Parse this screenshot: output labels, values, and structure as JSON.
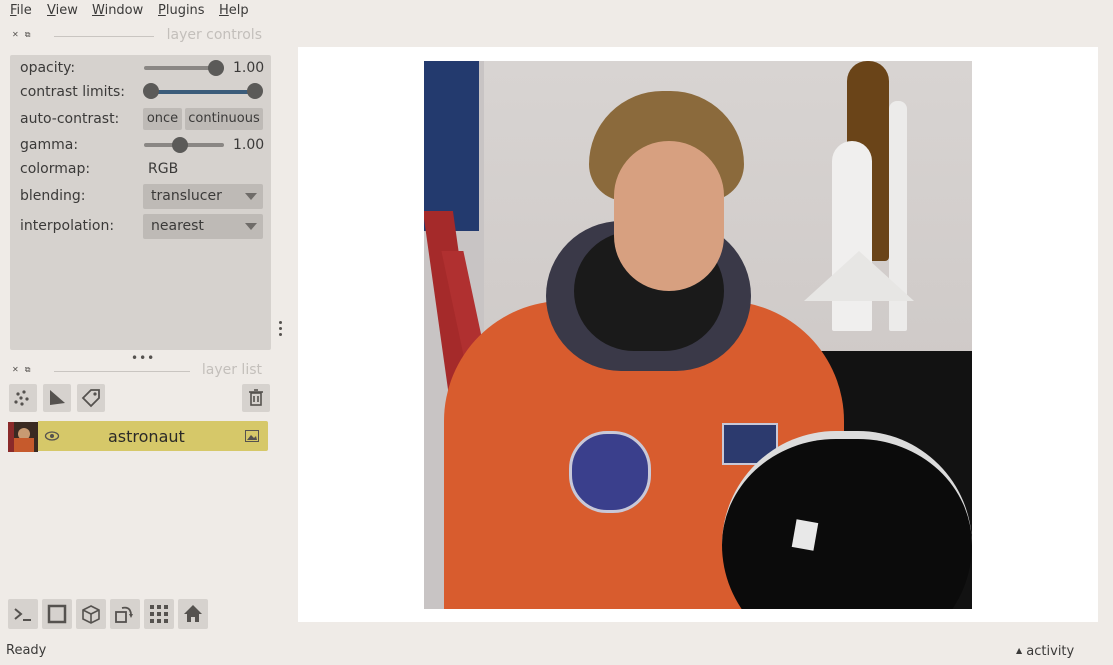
{
  "menu": [
    {
      "label": "File",
      "u": "F",
      "rest": "ile"
    },
    {
      "label": "View",
      "u": "V",
      "rest": "iew"
    },
    {
      "label": "Window",
      "u": "W",
      "rest": "indow"
    },
    {
      "label": "Plugins",
      "u": "P",
      "rest": "lugins"
    },
    {
      "label": "Help",
      "u": "H",
      "rest": "elp"
    }
  ],
  "layer_controls": {
    "title": "layer controls",
    "opacity_label": "opacity:",
    "opacity_value": "1.00",
    "opacity_level": 1.0,
    "contrast_label": "contrast limits:",
    "contrast_range": [
      0,
      1
    ],
    "auto_contrast_label": "auto-contrast:",
    "once_label": "once",
    "continuous_label": "continuous",
    "gamma_label": "gamma:",
    "gamma_value": "1.00",
    "colormap_label": "colormap:",
    "colormap_value": "RGB",
    "blending_label": "blending:",
    "blending_value": "translucer",
    "interpolation_label": "interpolation:",
    "interpolation_value": "nearest"
  },
  "layer_list": {
    "title": "layer list",
    "layers": [
      {
        "name": "astronaut",
        "visible": true
      }
    ]
  },
  "status": {
    "text": "Ready",
    "activity": "activity"
  },
  "colors": {
    "layer_selected": "#d6c869",
    "panel": "#d6d2ce",
    "background": "#efebe7",
    "canvas": "#ffffff"
  }
}
